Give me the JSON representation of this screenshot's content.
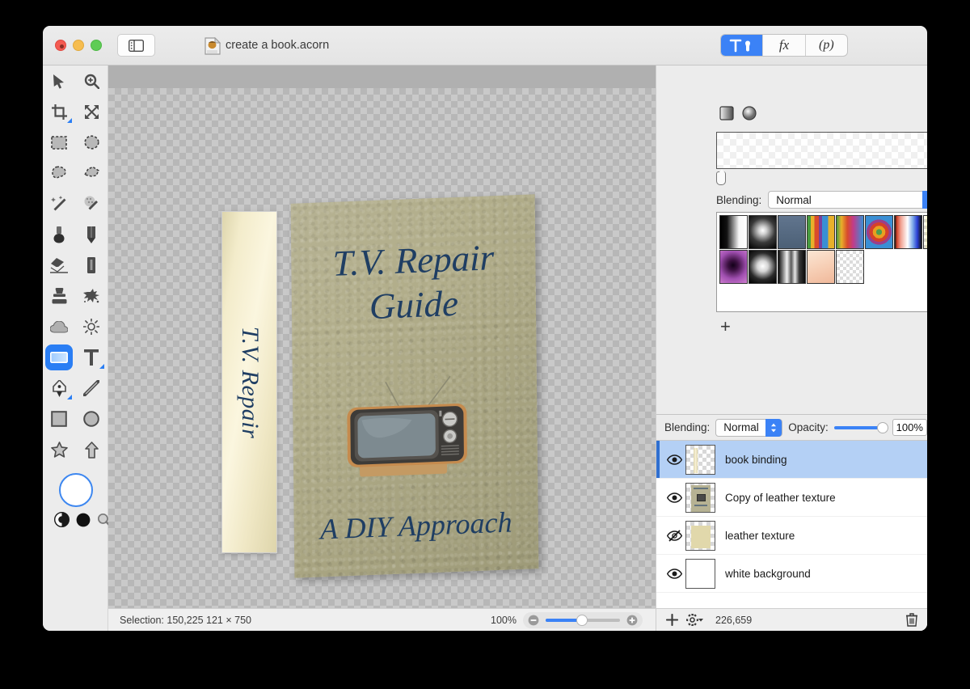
{
  "window": {
    "title": "create a book.acorn",
    "traffic_lights": [
      "close",
      "minimize",
      "zoom"
    ],
    "sidebar_toggle_icon": "sidebar-toggle-icon",
    "document_icon": "acorn-document-icon"
  },
  "segmented_control": {
    "items": [
      {
        "label": "",
        "icon": "tools-icon",
        "active": true
      },
      {
        "label": "fx",
        "icon": "fx-icon",
        "active": false
      },
      {
        "label": "(p)",
        "icon": "presets-icon",
        "active": false
      }
    ]
  },
  "tools": {
    "rows": [
      [
        {
          "name": "move-tool",
          "icon": "cursor-arrow-icon"
        },
        {
          "name": "zoom-tool",
          "icon": "magnifier-plus-icon"
        }
      ],
      [
        {
          "name": "crop-tool",
          "icon": "crop-icon",
          "badge": true
        },
        {
          "name": "transform-tool",
          "icon": "arrows-expand-icon"
        }
      ],
      [
        {
          "name": "rect-select-tool",
          "icon": "rect-marquee-icon"
        },
        {
          "name": "ellipse-select-tool",
          "icon": "ellipse-marquee-icon"
        }
      ],
      [
        {
          "name": "lasso-tool",
          "icon": "lasso-icon"
        },
        {
          "name": "polygon-lasso-tool",
          "icon": "polygon-lasso-icon"
        }
      ],
      [
        {
          "name": "magic-wand-tool",
          "icon": "magic-wand-icon"
        },
        {
          "name": "instant-alpha-tool",
          "icon": "magic-wand-dots-icon"
        }
      ],
      [
        {
          "name": "paint-bucket-tool",
          "icon": "bucket-icon"
        },
        {
          "name": "pencil-tool",
          "icon": "pencil-icon"
        }
      ],
      [
        {
          "name": "eraser-tool",
          "icon": "eraser-icon"
        },
        {
          "name": "marker-tool",
          "icon": "marker-icon"
        }
      ],
      [
        {
          "name": "clone-stamp-tool",
          "icon": "stamp-icon"
        },
        {
          "name": "smudge-tool",
          "icon": "smudge-icon"
        }
      ],
      [
        {
          "name": "blur-tool",
          "icon": "cloud-icon"
        },
        {
          "name": "dodge-tool",
          "icon": "sun-icon"
        }
      ],
      [
        {
          "name": "gradient-tool",
          "icon": "gradient-rect-icon",
          "selected": true
        },
        {
          "name": "text-tool",
          "icon": "text-t-icon",
          "badge": true
        }
      ],
      [
        {
          "name": "pen-tool",
          "icon": "pen-nib-icon",
          "badge": true
        },
        {
          "name": "line-tool",
          "icon": "line-icon"
        }
      ],
      [
        {
          "name": "rectangle-tool",
          "icon": "square-icon"
        },
        {
          "name": "ellipse-tool",
          "icon": "circle-icon"
        }
      ],
      [
        {
          "name": "star-tool",
          "icon": "star-icon"
        },
        {
          "name": "arrow-tool",
          "icon": "arrow-up-icon"
        }
      ]
    ],
    "color_well": {
      "name": "foreground-color-well",
      "color": "#ffffff",
      "ring": "#3d87f0"
    },
    "color_controls": [
      {
        "name": "swap-colors-icon",
        "icon": "yin-yang-icon"
      },
      {
        "name": "default-colors-icon",
        "icon": "black-dot-icon"
      },
      {
        "name": "color-picker-icon",
        "icon": "magnifier-icon"
      }
    ]
  },
  "canvas": {
    "cover": {
      "title_line1": "T.V. Repair",
      "title_line2": "Guide",
      "subtitle": "A DIY Approach",
      "bg_color": "#aba783",
      "text_color": "#1f3e63",
      "illustration": "retro-tv-icon"
    },
    "spine": {
      "text": "T.V. Repair",
      "bg_color": "#f3eccb",
      "text_color": "#1f3e63"
    }
  },
  "status_bar": {
    "selection": "Selection: 150,225 121 × 750",
    "zoom": "100%",
    "zoom_out_icon": "minus-circle-icon",
    "zoom_in_icon": "plus-circle-icon"
  },
  "inspector": {
    "gradient_shapes": [
      {
        "name": "linear-gradient-button",
        "icon": "linear-gradient-icon"
      },
      {
        "name": "radial-gradient-button",
        "icon": "radial-gradient-icon"
      }
    ],
    "blending_label": "Blending:",
    "blending_value": "Normal",
    "gradient_stops": 2,
    "presets": [
      {
        "name": "black-white-linear",
        "css": "linear-gradient(90deg,#000 0%,#111 25%,#f7f7f7 70%,#fff 100%)"
      },
      {
        "name": "white-radial",
        "css": "radial-gradient(circle at 50% 45%,#fff 0%,#cfcfcf 18%,#3a3a3a 55%,#000 100%)"
      },
      {
        "name": "blue-gray-linear",
        "css": "linear-gradient(180deg,#5f7590 0%,#4e6party 0%,#4c6076 100%)"
      },
      {
        "name": "rainbow-stripes",
        "css": "linear-gradient(90deg,#4a9b3f 0%,#4a9b3f 12%,#e8b02a 12%,#e8b02a 26%,#d94b2b 26%,#d94b2b 42%,#7a3f9e 42%,#7a3f9e 55%,#3a8fd4 55%,#3a8fd4 78%,#e8b02a 78%,#e8b02a 100%)"
      },
      {
        "name": "rainbow-smooth",
        "css": "linear-gradient(90deg,#4a9b3f 0%,#e8b02a 18%,#d94b2b 40%,#c23b8a 62%,#3a8fd4 100%)"
      },
      {
        "name": "bullseye-radial",
        "css": "radial-gradient(circle,#4f9e4f 0%,#4f9e4f 14%,#e8a020 14%,#e8a020 30%,#d6402a 30%,#d6402a 46%,#9b3f8a 46%,#9b3f8a 60%,#3a8fd4 60%)"
      },
      {
        "name": "red-white-blue",
        "css": "linear-gradient(90deg,#111 0%,#d4452b 8%,#f0a090 22%,#ffffff 48%,#7aa6e8 68%,#2b3fd6 84%,#111 100%)"
      },
      {
        "name": "yellow-transparent",
        "css": "linear-gradient(90deg,rgba(255,230,60,0) 0%,#f5e23c 45%,rgba(255,230,60,0) 100%)"
      },
      {
        "name": "purple-radial",
        "css": "radial-gradient(circle at 48% 45%,#120018 0%,#3b1040 22%,#a04fb0 60%,#cf7fd0 100%)"
      },
      {
        "name": "white-soft-radial",
        "css": "radial-gradient(circle at 50% 48%,#fff 0%,#d5d5d5 25%,#2a2a2a 62%,#000 100%)"
      },
      {
        "name": "metallic-stripes",
        "css": "linear-gradient(90deg,#0a0a0a 0%,#8a8a8a 18%,#f2f2f2 32%,#5a5a5a 48%,#e8e8e8 62%,#3a3a3a 78%,#0a0a0a 100%)"
      },
      {
        "name": "peach-soft",
        "css": "linear-gradient(160deg,#fbe6d4 0%,#f6cdb3 55%,#f0b89a 100%)"
      },
      {
        "name": "transparent-empty",
        "css": "transparent"
      }
    ],
    "add_preset_icon": "plus-icon"
  },
  "layers": {
    "blending_label": "Blending:",
    "blending_value": "Normal",
    "opacity_label": "Opacity:",
    "opacity_value": "100%",
    "items": [
      {
        "name": "book binding",
        "visible": true,
        "selected": true,
        "thumb": "binding-thumb"
      },
      {
        "name": "Copy of leather texture",
        "visible": true,
        "selected": false,
        "thumb": "cover-thumb"
      },
      {
        "name": "leather texture",
        "visible": false,
        "selected": false,
        "thumb": "leather-thumb"
      },
      {
        "name": "white background",
        "visible": true,
        "selected": false,
        "thumb": "white-thumb"
      }
    ],
    "footer": {
      "add_icon": "plus-icon",
      "settings_icon": "gear-icon",
      "count": "226,659",
      "delete_icon": "trash-icon"
    }
  }
}
